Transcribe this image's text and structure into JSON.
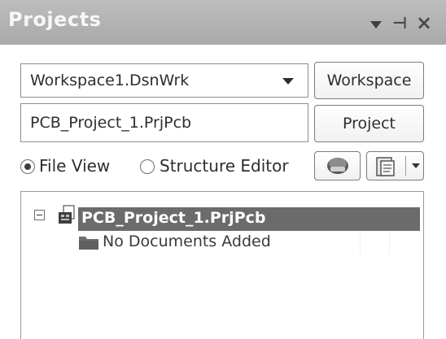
{
  "panel": {
    "title": "Projects",
    "title_icons": [
      "menu-arrow-icon",
      "pin-icon",
      "close-icon"
    ]
  },
  "workspace": {
    "combo_value": "Workspace1.DsnWrk",
    "button_label": "Workspace"
  },
  "project": {
    "field_value": "PCB_Project_1.PrjPcb",
    "button_label": "Project"
  },
  "view_mode": {
    "options": [
      {
        "label": "File View",
        "selected": true
      },
      {
        "label": "Structure Editor",
        "selected": false
      }
    ]
  },
  "toolbar": {
    "icons": [
      "project-settings-icon",
      "document-options-icon"
    ]
  },
  "tree": {
    "items": [
      {
        "label": "PCB_Project_1.PrjPcb",
        "selected": true,
        "expanded": true,
        "icon": "pcb-project-icon"
      },
      {
        "label": "No Documents Added",
        "selected": false,
        "icon": "folder-icon"
      }
    ]
  },
  "colors": {
    "title_bar": "#b3b3b3",
    "selection": "#6b6b6b"
  }
}
